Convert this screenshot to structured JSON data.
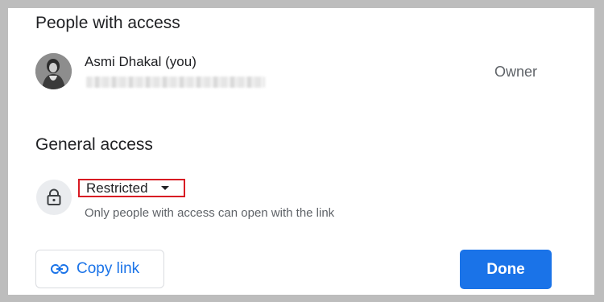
{
  "people_section": {
    "title": "People with access",
    "person": {
      "name": "Asmi Dhakal (you)",
      "role": "Owner"
    }
  },
  "general_section": {
    "title": "General access",
    "access_level": "Restricted",
    "description": "Only people with access can open with the link"
  },
  "actions": {
    "copy_link_label": "Copy link",
    "done_label": "Done"
  },
  "colors": {
    "accent": "#1a73e8",
    "highlight_border": "#d81b23"
  }
}
